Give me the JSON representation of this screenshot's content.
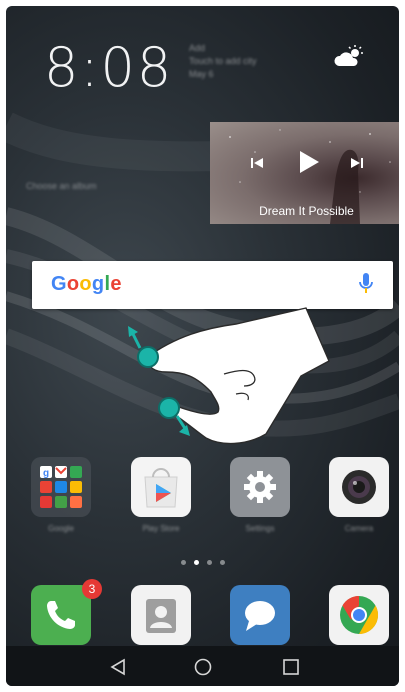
{
  "status": {
    "time": "8:08",
    "line1": "Add",
    "line2": "Touch to add city",
    "line3": "May 6"
  },
  "music": {
    "title": "Dream It Possible",
    "album_caption": "Choose an album"
  },
  "search": {
    "brand": "Google"
  },
  "apps": [
    {
      "label": "Google"
    },
    {
      "label": "Play Store"
    },
    {
      "label": "Settings"
    },
    {
      "label": "Camera"
    }
  ],
  "dock": {
    "phone_badge": "3"
  },
  "colors": {
    "phone": "#4caf50",
    "contacts": "#f2f2f2",
    "messages": "#3e7fc1",
    "settings": "#8e9297",
    "gesture_circle": "#1bb4a8",
    "mic": "#4285f4"
  },
  "icons": {
    "weather": "cloud-sun-icon",
    "gesture": "pinch-hand-icon"
  },
  "pager": {
    "count": 4,
    "active_index": 1
  }
}
